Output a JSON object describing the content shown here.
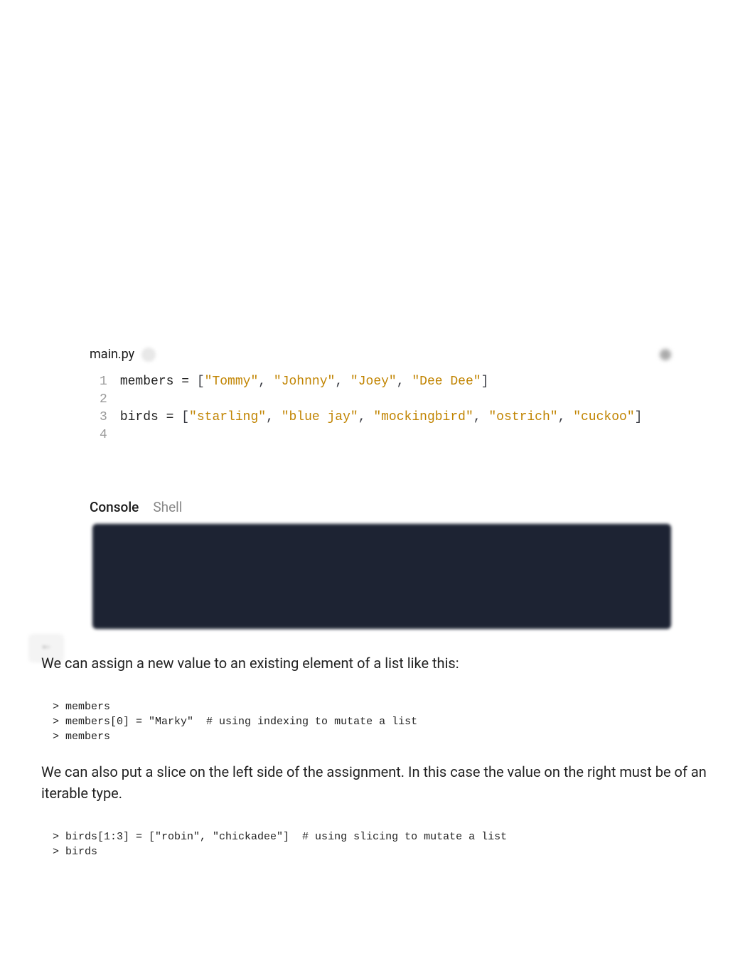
{
  "editor": {
    "filename": "main.py",
    "lines": {
      "n1": "1",
      "n2": "2",
      "n3": "3",
      "n4": "4"
    },
    "code": {
      "l1": {
        "var": "members",
        "eq": " = ",
        "lb": "[",
        "s1": "\"Tommy\"",
        "c1": ", ",
        "s2": "\"Johnny\"",
        "c2": ", ",
        "s3": "\"Joey\"",
        "c3": ", ",
        "s4": "\"Dee Dee\"",
        "rb": "]"
      },
      "l3": {
        "var": "birds",
        "eq": " = ",
        "lb": "[",
        "s1": "\"starling\"",
        "c1": ", ",
        "s2": "\"blue jay\"",
        "c2": ", ",
        "s3": "\"mockingbird\"",
        "c3": ", ",
        "s4": "\"ostrich\"",
        "c4": ", ",
        "s5": "\"cuckoo\"",
        "rb": "]"
      }
    }
  },
  "console": {
    "tab_console": "Console",
    "tab_shell": "Shell"
  },
  "text": {
    "p1": "We can assign a new value to an existing element of a list like this:",
    "cb1": {
      "l1": "> members",
      "l2": "> members[0] = \"Marky\"  # using indexing to mutate a list",
      "l3": "> members"
    },
    "p2": "We can also put a slice on the left side of the assignment. In this case the value on the right must be of an iterable type.",
    "cb2": {
      "l1": "> birds[1:3] = [\"robin\", \"chickadee\"]  # using slicing to mutate a list",
      "l2": "> birds"
    }
  }
}
